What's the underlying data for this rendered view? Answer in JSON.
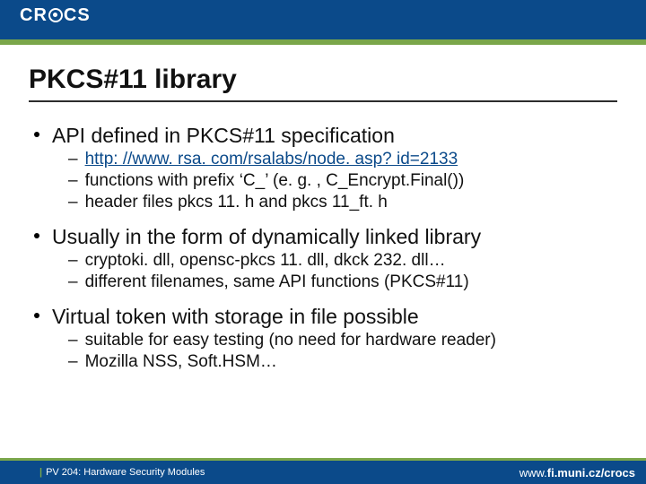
{
  "header": {
    "logo_prefix": "CR",
    "logo_suffix": "CS"
  },
  "title": "PKCS#11 library",
  "bullets": {
    "b1": "API defined in PKCS#11 specification",
    "b1_1_link": "http: //www. rsa. com/rsalabs/node. asp? id=2133",
    "b1_2": "functions with prefix ‘C_’ (e. g. , C_Encrypt.Final())",
    "b1_3": "header files pkcs 11. h and pkcs 11_ft. h",
    "b2": "Usually in the form of dynamically linked library",
    "b2_1": "cryptoki. dll, opensc-pkcs 11. dll, dkck 232. dll…",
    "b2_2": "different filenames, same API functions (PKCS#11)",
    "b3": "Virtual token with storage in file possible",
    "b3_1": "suitable for easy testing (no need for hardware reader)",
    "b3_2": "Mozilla NSS, Soft.HSM…"
  },
  "footer": {
    "left": "PV 204: Hardware Security Modules",
    "right_prefix": "www.",
    "right_main": "fi.muni.cz/crocs"
  }
}
